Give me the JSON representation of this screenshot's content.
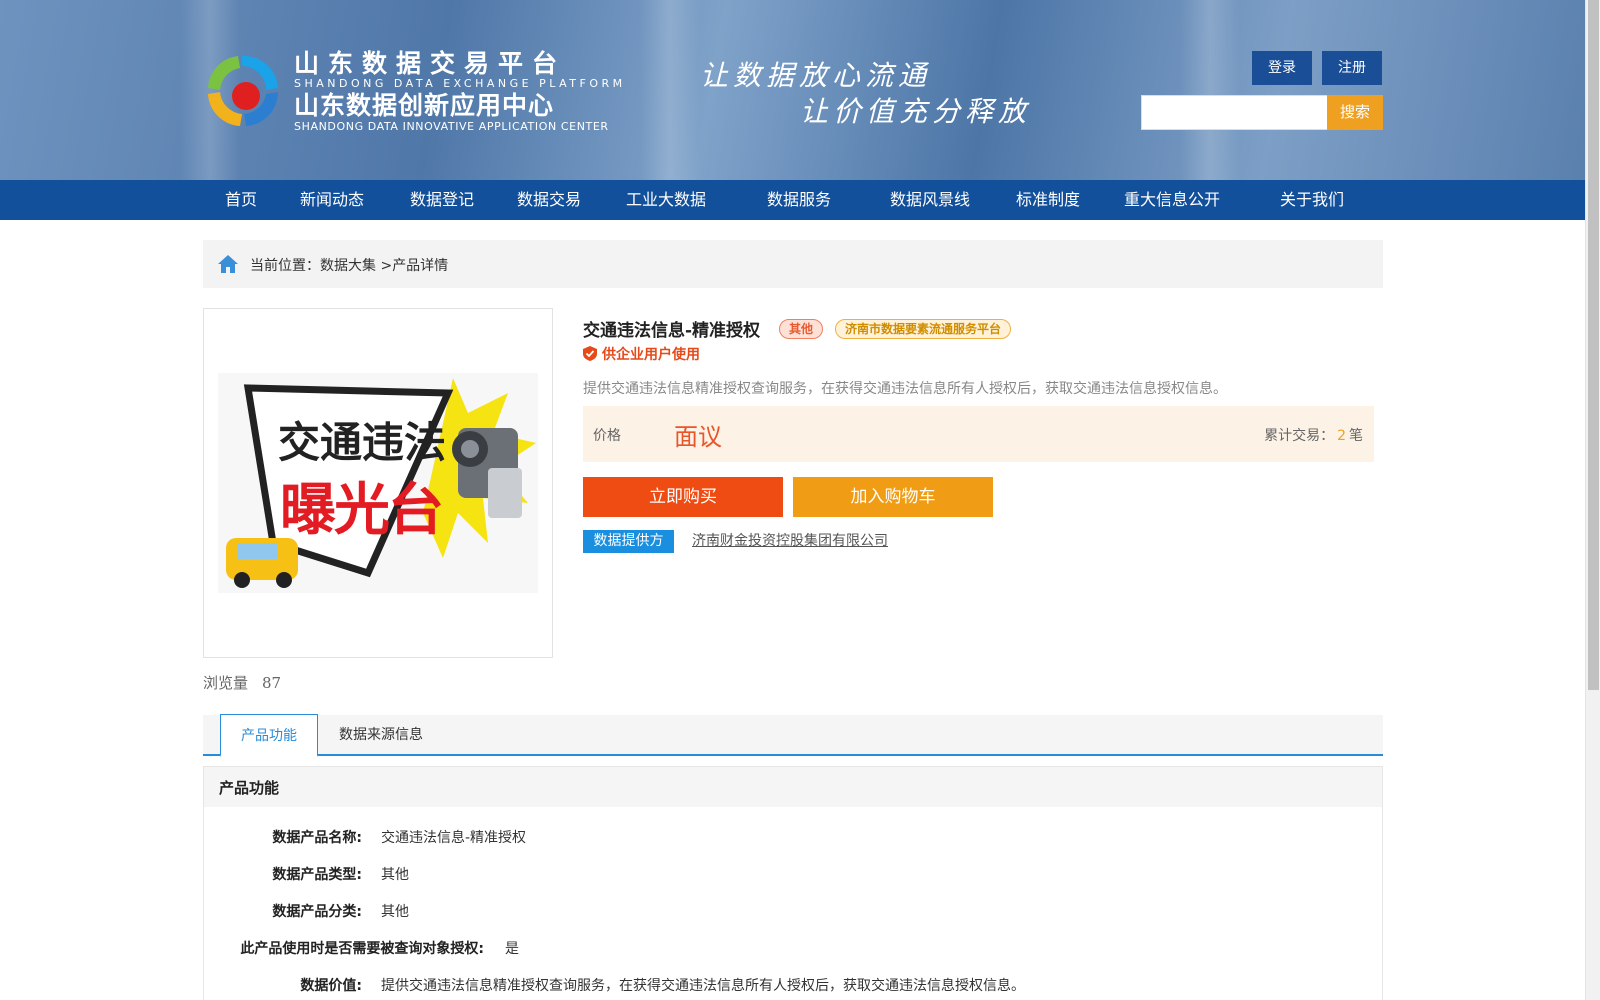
{
  "header": {
    "logo_title_cn": "山东数据交易平台",
    "logo_title_en": "SHANDONG DATA EXCHANGE PLATFORM",
    "logo_sub_cn": "山东数据创新应用中心",
    "logo_sub_en": "SHANDONG DATA INNOVATIVE APPLICATION CENTER",
    "slogan_1": "让数据放心流通",
    "slogan_2": "让价值充分释放",
    "login_label": "登录",
    "register_label": "注册",
    "search_value": "",
    "search_label": "搜索"
  },
  "nav": {
    "items": [
      "首页",
      "新闻动态",
      "数据登记",
      "数据交易",
      "工业大数据",
      "数据服务",
      "数据风景线",
      "标准制度",
      "重大信息公开",
      "关于我们"
    ]
  },
  "breadcrumb": {
    "prefix": "当前位置：",
    "path": "数据大集",
    "separator": ">",
    "current": "产品详情"
  },
  "product": {
    "image_text_1": "交通违法",
    "image_text_2": "曝光台",
    "views_label": "浏览量",
    "views_count": "87",
    "title": "交通违法信息-精准授权",
    "tag_category": "其他",
    "tag_platform": "济南市数据要素流通服务平台",
    "audience": "供企业用户使用",
    "description": "提供交通违法信息精准授权查询服务，在获得交通违法信息所有人授权后，获取交通违法信息授权信息。",
    "price_label": "价格",
    "price_value": "面议",
    "trade_label": "累计交易：",
    "trade_count": "2",
    "trade_unit": "笔",
    "buy_label": "立即购买",
    "cart_label": "加入购物车",
    "provider_label": "数据提供方",
    "provider_name": "济南财金投资控股集团有限公司"
  },
  "tabs": {
    "items": [
      "产品功能",
      "数据来源信息"
    ],
    "active": "产品功能"
  },
  "detail": {
    "heading": "产品功能",
    "rows": [
      {
        "key": "数据产品名称:",
        "value": "交通违法信息-精准授权"
      },
      {
        "key": "数据产品类型:",
        "value": "其他"
      },
      {
        "key": "数据产品分类:",
        "value": "其他"
      },
      {
        "key": "此产品使用时是否需要被查询对象授权:",
        "value": "是"
      },
      {
        "key": "数据价值:",
        "value": "提供交通违法信息精准授权查询服务，在获得交通违法信息所有人授权后，获取交通违法信息授权信息。"
      }
    ]
  },
  "colors": {
    "nav_bg": "#12509b",
    "accent_orange": "#f0a020",
    "buy_red": "#ef4c14",
    "tab_blue": "#2a8cd8"
  }
}
